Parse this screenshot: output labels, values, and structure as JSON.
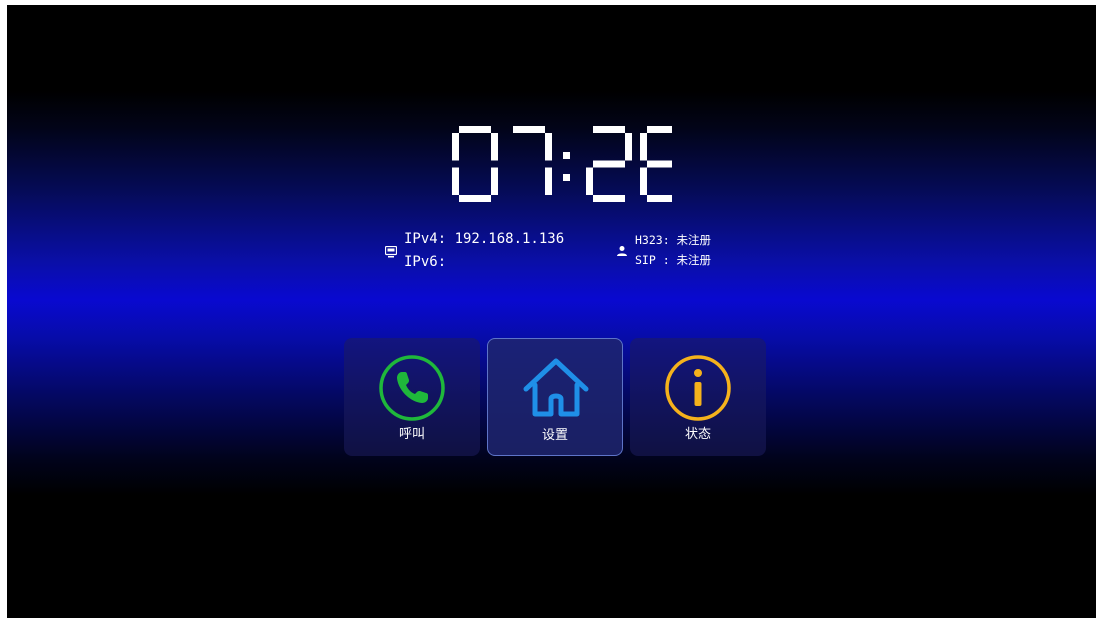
{
  "clock": {
    "time": "07:26",
    "color": "#ffffff"
  },
  "network": {
    "icon": "network-icon",
    "ipv4": "IPv4: 192.168.1.136",
    "ipv6": "IPv6:"
  },
  "registration": {
    "icon": "user-icon",
    "h323": "H323: 未注册",
    "sip": "SIP : 未注册"
  },
  "menu": [
    {
      "label": "呼叫",
      "icon": "phone-icon",
      "color": "#1fb83b",
      "selected": false
    },
    {
      "label": "设置",
      "icon": "home-icon",
      "color": "#1f8fe8",
      "selected": true
    },
    {
      "label": "状态",
      "icon": "info-icon",
      "color": "#f5b21c",
      "selected": false
    }
  ],
  "colors": {
    "background_center": "#0909d0",
    "background_edge": "#000000",
    "selected_border": "#5e74c8"
  }
}
